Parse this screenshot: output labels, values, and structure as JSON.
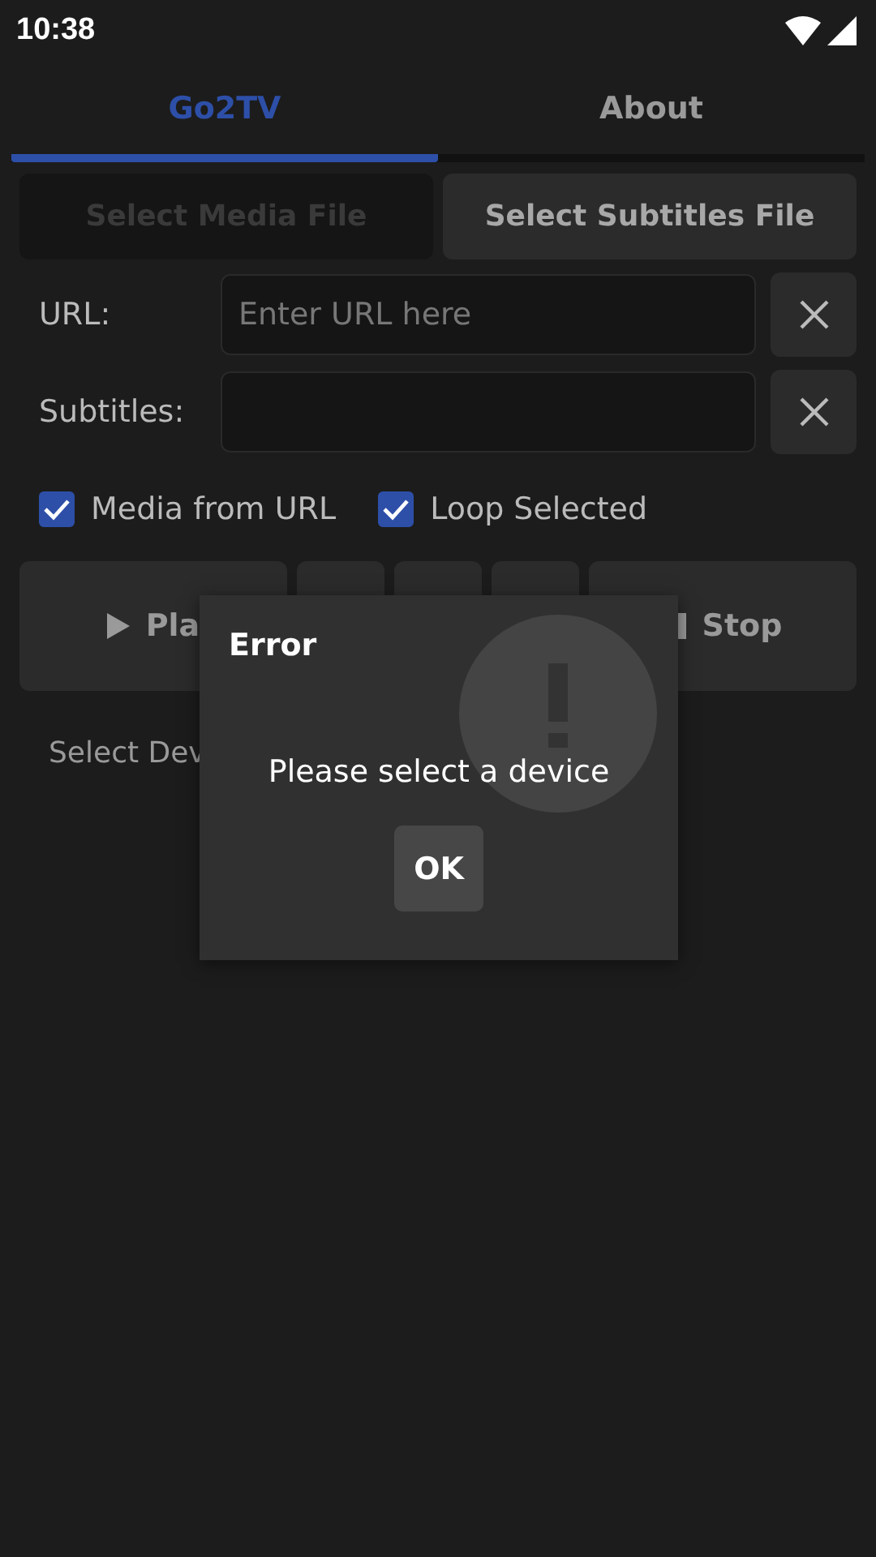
{
  "status_bar": {
    "time": "10:38"
  },
  "tabs": [
    {
      "label": "Go2TV",
      "selected": true
    },
    {
      "label": "About",
      "selected": false
    }
  ],
  "file_buttons": [
    {
      "label": "Select Media File",
      "disabled": true
    },
    {
      "label": "Select Subtitles File",
      "disabled": false
    }
  ],
  "fields": [
    {
      "label": "URL:",
      "placeholder": "Enter URL here"
    },
    {
      "label": "Subtitles:"
    }
  ],
  "checkboxes": [
    {
      "label": "Media from URL",
      "checked": true
    },
    {
      "label": "Loop Selected",
      "checked": true
    }
  ],
  "controls": [
    {
      "kind": "play",
      "label": "Pla"
    },
    {
      "kind": "blank"
    },
    {
      "kind": "blank"
    },
    {
      "kind": "blank"
    },
    {
      "kind": "stop",
      "label": "Stop"
    }
  ],
  "device_label": "Select Dev",
  "dialog": {
    "title": "Error",
    "message": "Please select a device",
    "button": "OK"
  }
}
